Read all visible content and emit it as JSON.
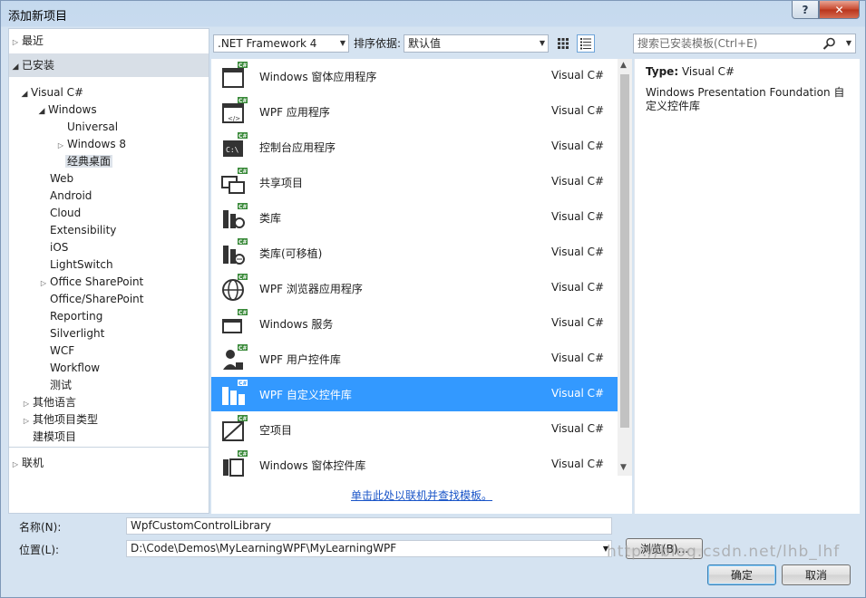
{
  "window": {
    "title": "添加新项目",
    "help_label": "?",
    "close_label": "✕"
  },
  "tree": {
    "recent": "最近",
    "installed": "已安装",
    "items": [
      {
        "label": "Visual C#"
      },
      {
        "label": "Windows"
      },
      {
        "label": "Universal"
      },
      {
        "label": "Windows 8"
      },
      {
        "label": "经典桌面"
      },
      {
        "label": "Web"
      },
      {
        "label": "Android"
      },
      {
        "label": "Cloud"
      },
      {
        "label": "Extensibility"
      },
      {
        "label": "iOS"
      },
      {
        "label": "LightSwitch"
      },
      {
        "label": "Office SharePoint"
      },
      {
        "label": "Office/SharePoint"
      },
      {
        "label": "Reporting"
      },
      {
        "label": "Silverlight"
      },
      {
        "label": "WCF"
      },
      {
        "label": "Workflow"
      },
      {
        "label": "测试"
      },
      {
        "label": "其他语言"
      },
      {
        "label": "其他项目类型"
      },
      {
        "label": "建模项目"
      }
    ],
    "online": "联机"
  },
  "toolbar": {
    "framework": ".NET Framework 4",
    "sort_label": "排序依据:",
    "sort_value": "默认值",
    "search_placeholder": "搜索已安装模板(Ctrl+E)"
  },
  "templates": [
    {
      "name": "Windows 窗体应用程序",
      "lang": "Visual C#",
      "icon": "winforms-app-icon"
    },
    {
      "name": "WPF 应用程序",
      "lang": "Visual C#",
      "icon": "wpf-app-icon"
    },
    {
      "name": "控制台应用程序",
      "lang": "Visual C#",
      "icon": "console-app-icon"
    },
    {
      "name": "共享项目",
      "lang": "Visual C#",
      "icon": "shared-project-icon"
    },
    {
      "name": "类库",
      "lang": "Visual C#",
      "icon": "class-library-icon"
    },
    {
      "name": "类库(可移植)",
      "lang": "Visual C#",
      "icon": "portable-library-icon"
    },
    {
      "name": "WPF 浏览器应用程序",
      "lang": "Visual C#",
      "icon": "wpf-browser-app-icon"
    },
    {
      "name": "Windows 服务",
      "lang": "Visual C#",
      "icon": "windows-service-icon"
    },
    {
      "name": "WPF 用户控件库",
      "lang": "Visual C#",
      "icon": "wpf-user-control-icon"
    },
    {
      "name": "WPF 自定义控件库",
      "lang": "Visual C#",
      "icon": "wpf-custom-control-icon"
    },
    {
      "name": "空项目",
      "lang": "Visual C#",
      "icon": "empty-project-icon"
    },
    {
      "name": "Windows 窗体控件库",
      "lang": "Visual C#",
      "icon": "winforms-control-icon"
    }
  ],
  "selected_template_index": 9,
  "online_link": "单击此处以联机并查找模板。",
  "description": {
    "type_label": "Type:",
    "type_value": "Visual C#",
    "text": "Windows Presentation Foundation 自定义控件库"
  },
  "form": {
    "name_label": "名称(N):",
    "name_value": "WpfCustomControlLibrary",
    "location_label": "位置(L):",
    "location_value": "D:\\Code\\Demos\\MyLearningWPF\\MyLearningWPF",
    "browse_label": "浏览(B)...",
    "ok_label": "确定",
    "cancel_label": "取消"
  },
  "watermark": "http://blog.csdn.net/lhb_lhf",
  "colors": {
    "selection": "#3399ff",
    "link": "#1a55c8",
    "csharp_badge": "#3a8a3a"
  }
}
